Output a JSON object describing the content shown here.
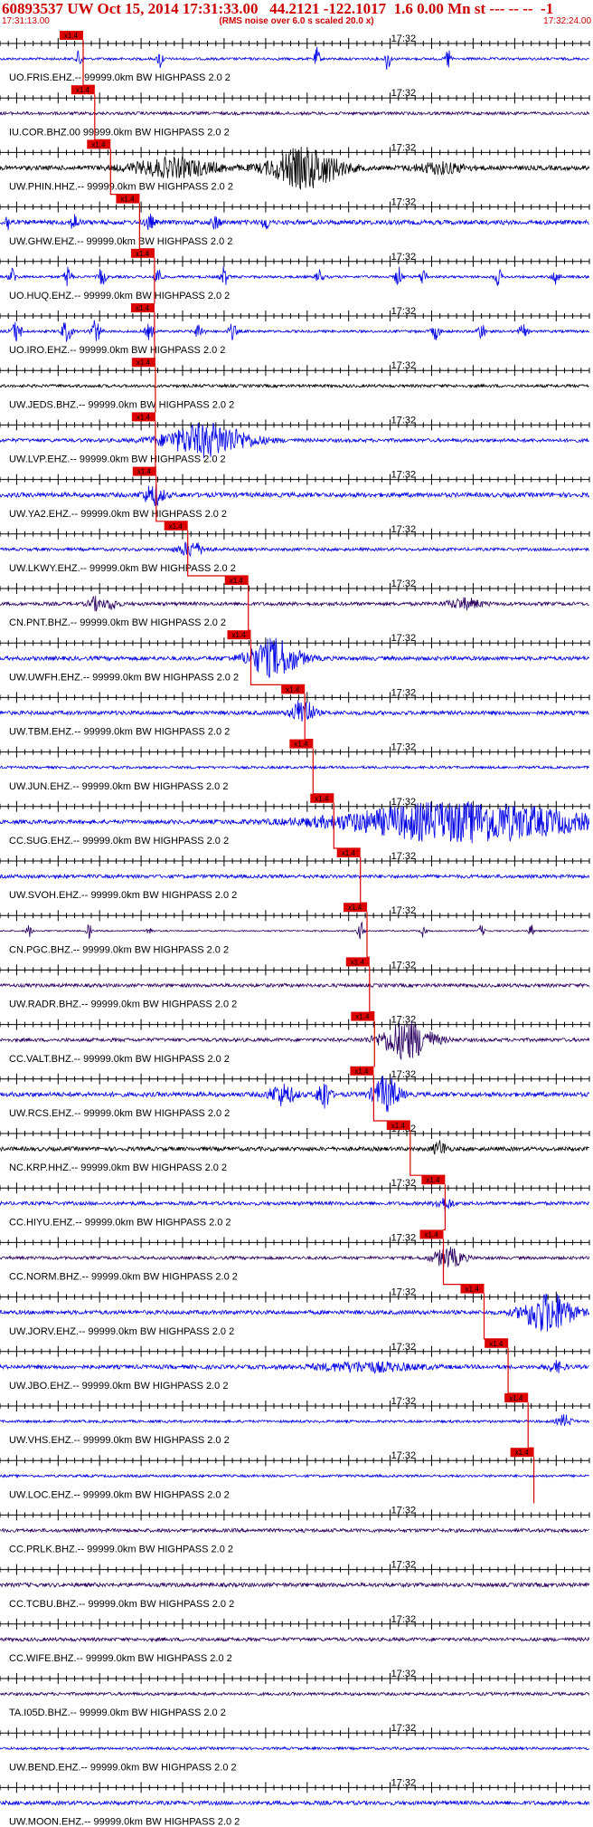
{
  "header": {
    "title": "60893537 UW Oct 15, 2014 17:31:33.00   44.2121 -122.1017  1.6 0.00 Mn st --- -- --  -1",
    "subtitle": "(RMS noise over 6.0 s scaled 20.0 x)",
    "time_start": "17:31:13.00",
    "time_end": "17:32:24.00"
  },
  "chart_data": {
    "type": "line",
    "x_range_seconds_after_start": [
      0,
      71
    ],
    "minute_mark_label": "17:32",
    "minute_mark_seconds": 47,
    "pick_label": "x1.4",
    "colors": {
      "dark": "#000000",
      "blue": "#0000e6",
      "purple": "#2b0060",
      "pick": "#dd0000",
      "axis": "#000000"
    },
    "traces": [
      {
        "label": "UO.FRIS.EHZ.-- 99999.0km BW  HIGHPASS  2.0  2",
        "color": "blue",
        "pick_s": 8.6,
        "noise": 0.1,
        "bursts": [
          [
            9.6,
            0.3,
            1.0
          ],
          [
            19.3,
            0.3,
            0.9
          ],
          [
            38.2,
            0.3,
            0.9
          ],
          [
            46.7,
            0.3,
            1.0
          ],
          [
            54.0,
            0.3,
            0.9
          ]
        ]
      },
      {
        "label": "IU.COR.BHZ.00 99999.0km BW  HIGHPASS  2.0  2",
        "color": "purple",
        "pick_s": 10.0,
        "noise": 0.12,
        "bursts": []
      },
      {
        "label": "UW.PHIN.HHZ.-- 99999.0km BW  HIGHPASS  2.0  2",
        "color": "dark",
        "pick_s": 11.9,
        "noise": 0.18,
        "bursts": [
          [
            21.0,
            5.0,
            0.7
          ],
          [
            36.8,
            4.0,
            1.6
          ],
          [
            53.0,
            3.0,
            0.4
          ]
        ]
      },
      {
        "label": "UW.GHW.EHZ.-- 99999.0km BW  HIGHPASS  2.0  2",
        "color": "blue",
        "pick_s": 15.4,
        "noise": 0.18,
        "bursts": [
          [
            1.0,
            0.4,
            0.6
          ],
          [
            9.0,
            0.5,
            0.6
          ],
          [
            18.0,
            0.5,
            0.6
          ],
          [
            26.0,
            0.5,
            0.5
          ],
          [
            32.0,
            0.4,
            0.6
          ]
        ]
      },
      {
        "label": "UO.HUQ.EHZ.-- 99999.0km BW  HIGHPASS  2.0  2",
        "color": "blue",
        "pick_s": 17.2,
        "noise": 0.1,
        "bursts": [
          [
            1.5,
            0.4,
            0.7
          ],
          [
            8.2,
            0.4,
            0.9
          ],
          [
            12.3,
            0.4,
            0.8
          ],
          [
            19.0,
            0.4,
            0.8
          ],
          [
            27.0,
            0.4,
            0.8
          ],
          [
            38.5,
            0.4,
            0.6
          ],
          [
            48.0,
            0.4,
            0.8
          ],
          [
            51.0,
            0.4,
            0.7
          ],
          [
            60.0,
            0.4,
            0.7
          ],
          [
            67.0,
            0.4,
            0.7
          ]
        ]
      },
      {
        "label": "UO.IRO.EHZ.-- 99999.0km BW  HIGHPASS  2.0  2",
        "color": "blue",
        "pick_s": 17.2,
        "noise": 0.1,
        "bursts": [
          [
            2.0,
            0.6,
            0.8
          ],
          [
            8.0,
            0.6,
            0.8
          ],
          [
            11.5,
            0.6,
            0.9
          ],
          [
            18.0,
            0.5,
            0.6
          ],
          [
            24.0,
            0.5,
            0.6
          ],
          [
            28.0,
            0.5,
            0.6
          ],
          [
            52.5,
            0.5,
            0.6
          ],
          [
            58.0,
            0.5,
            0.6
          ],
          [
            63.0,
            0.5,
            0.5
          ]
        ]
      },
      {
        "label": "UW.JEDS.BHZ.-- 99999.0km BW  HIGHPASS  2.0  2",
        "color": "dark",
        "pick_s": 17.3,
        "noise": 0.12,
        "bursts": []
      },
      {
        "label": "UW.LVP.EHZ.-- 99999.0km BW  HIGHPASS  2.0  2",
        "color": "blue",
        "pick_s": 17.3,
        "noise": 0.14,
        "bursts": [
          [
            25.0,
            5.0,
            1.3
          ]
        ]
      },
      {
        "label": "UW.YA2.EHZ.-- 99999.0km BW  HIGHPASS  2.0  2",
        "color": "blue",
        "pick_s": 17.4,
        "noise": 0.18,
        "bursts": [
          [
            18.5,
            1.2,
            0.8
          ]
        ]
      },
      {
        "label": "UW.LKWY.EHZ.-- 99999.0km BW  HIGHPASS  2.0  2",
        "color": "blue",
        "pick_s": 21.2,
        "noise": 0.12,
        "bursts": [
          [
            23.0,
            1.5,
            0.6
          ]
        ]
      },
      {
        "label": "CN.PNT.BHZ.-- 99999.0km BW  HIGHPASS  2.0  2",
        "color": "purple",
        "pick_s": 28.5,
        "noise": 0.14,
        "bursts": [
          [
            11.5,
            0.8,
            0.5
          ],
          [
            13.5,
            0.8,
            0.4
          ],
          [
            56.0,
            2.0,
            0.4
          ]
        ]
      },
      {
        "label": "UW.UWFH.EHZ.-- 99999.0km BW  HIGHPASS  2.0  2",
        "color": "blue",
        "pick_s": 28.8,
        "noise": 0.16,
        "bursts": [
          [
            33.0,
            3.0,
            1.5
          ]
        ]
      },
      {
        "label": "UW.TBM.EHZ.-- 99999.0km BW  HIGHPASS  2.0  2",
        "color": "blue",
        "pick_s": 35.3,
        "noise": 0.16,
        "bursts": [
          [
            36.5,
            1.2,
            1.2
          ]
        ]
      },
      {
        "label": "UW.JUN.EHZ.-- 99999.0km BW  HIGHPASS  2.0  2",
        "color": "blue",
        "pick_s": 36.3,
        "noise": 0.1,
        "bursts": []
      },
      {
        "label": "CC.SUG.EHZ.-- 99999.0km BW  HIGHPASS  2.0  2",
        "color": "blue",
        "pick_s": 38.8,
        "noise": 0.16,
        "bursts": [
          [
            56.0,
            14.0,
            1.6
          ]
        ]
      },
      {
        "label": "UW.SVOH.EHZ.-- 99999.0km BW  HIGHPASS  2.0  2",
        "color": "blue",
        "pick_s": 42.0,
        "noise": 0.14,
        "bursts": []
      },
      {
        "label": "CN.PGC.BHZ.-- 99999.0km BW  HIGHPASS  2.0  2",
        "color": "purple",
        "pick_s": 42.8,
        "noise": 0.06,
        "bursts": [
          [
            3.5,
            0.3,
            0.6
          ],
          [
            10.7,
            0.3,
            0.6
          ],
          [
            18.0,
            0.3,
            0.5
          ],
          [
            43.5,
            0.4,
            0.7
          ],
          [
            51.0,
            0.3,
            0.5
          ],
          [
            58.0,
            0.3,
            0.5
          ],
          [
            64.0,
            0.3,
            0.5
          ]
        ]
      },
      {
        "label": "UW.RADR.BHZ.-- 99999.0km BW  HIGHPASS  2.0  2",
        "color": "purple",
        "pick_s": 43.1,
        "noise": 0.14,
        "bursts": []
      },
      {
        "label": "CC.VALT.BHZ.-- 99999.0km BW  HIGHPASS  2.0  2",
        "color": "purple",
        "pick_s": 43.7,
        "noise": 0.14,
        "bursts": [
          [
            49.0,
            3.0,
            1.5
          ]
        ]
      },
      {
        "label": "UW.RCS.EHZ.-- 99999.0km BW  HIGHPASS  2.0  2",
        "color": "blue",
        "pick_s": 43.6,
        "noise": 0.18,
        "bursts": [
          [
            34.0,
            1.5,
            0.8
          ],
          [
            39.0,
            0.7,
            1.3
          ],
          [
            46.5,
            1.5,
            1.4
          ]
        ]
      },
      {
        "label": "NC.KRP.HHZ.-- 99999.0km BW  HIGHPASS  2.0  2",
        "color": "dark",
        "pick_s": 48.0,
        "noise": 0.16,
        "bursts": [
          [
            53.0,
            0.8,
            0.6
          ]
        ]
      },
      {
        "label": "CC.HIYU.EHZ.-- 99999.0km BW  HIGHPASS  2.0  2",
        "color": "blue",
        "pick_s": 52.2,
        "noise": 0.14,
        "bursts": [
          [
            53.5,
            1.0,
            0.5
          ]
        ]
      },
      {
        "label": "CC.NORM.BHZ.-- 99999.0km BW  HIGHPASS  2.0  2",
        "color": "purple",
        "pick_s": 52.0,
        "noise": 0.12,
        "bursts": [
          [
            54.0,
            1.8,
            0.8
          ]
        ]
      },
      {
        "label": "UW.JORV.EHZ.-- 99999.0km BW  HIGHPASS  2.0  2",
        "color": "blue",
        "pick_s": 56.9,
        "noise": 0.16,
        "bursts": [
          [
            66.0,
            2.8,
            1.7
          ]
        ]
      },
      {
        "label": "UW.JBO.EHZ.-- 99999.0km BW  HIGHPASS  2.0  2",
        "color": "blue",
        "pick_s": 59.8,
        "noise": 0.16,
        "bursts": [
          [
            44.0,
            6.0,
            0.35
          ],
          [
            67.0,
            1.0,
            0.4
          ]
        ]
      },
      {
        "label": "UW.VHS.EHZ.-- 99999.0km BW  HIGHPASS  2.0  2",
        "color": "blue",
        "pick_s": 62.2,
        "noise": 0.1,
        "bursts": [
          [
            68.0,
            0.8,
            0.5
          ]
        ]
      },
      {
        "label": "UW.LOC.EHZ.-- 99999.0km BW  HIGHPASS  2.0  2",
        "color": "blue",
        "pick_s": 62.9,
        "noise": 0.1,
        "bursts": []
      },
      {
        "label": "CC.PRLK.BHZ.-- 99999.0km BW  HIGHPASS  2.0  2",
        "color": "purple",
        "pick_s": null,
        "noise": 0.14,
        "bursts": []
      },
      {
        "label": "CC.TCBU.BHZ.-- 99999.0km BW  HIGHPASS  2.0  2",
        "color": "purple",
        "pick_s": null,
        "noise": 0.16,
        "bursts": []
      },
      {
        "label": "CC.WIFE.BHZ.-- 99999.0km BW  HIGHPASS  2.0  2",
        "color": "purple",
        "pick_s": null,
        "noise": 0.14,
        "bursts": []
      },
      {
        "label": "TA.I05D.BHZ.-- 99999.0km BW  HIGHPASS  2.0  2",
        "color": "purple",
        "pick_s": null,
        "noise": 0.12,
        "bursts": []
      },
      {
        "label": "UW.BEND.EHZ.-- 99999.0km BW  HIGHPASS  2.0  2",
        "color": "blue",
        "pick_s": null,
        "noise": 0.1,
        "bursts": []
      },
      {
        "label": "UW.MOON.EHZ.-- 99999.0km BW  HIGHPASS  2.0  2",
        "color": "blue",
        "pick_s": null,
        "noise": 0.16,
        "bursts": []
      }
    ]
  }
}
